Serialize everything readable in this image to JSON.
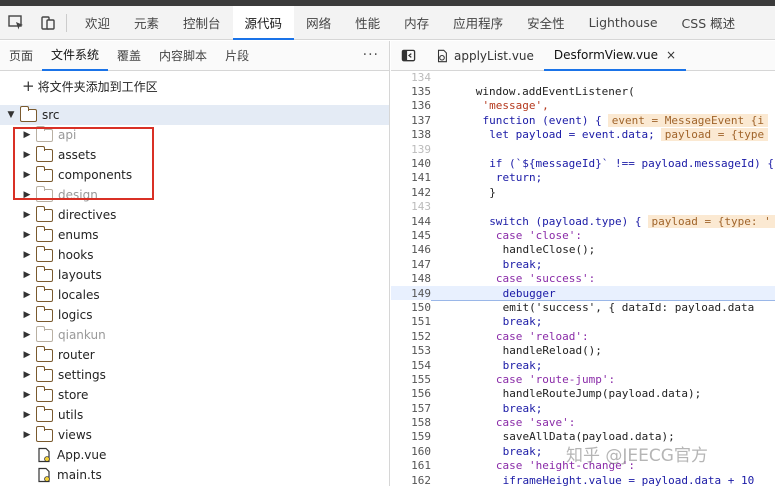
{
  "devtools_tabs": [
    "欢迎",
    "元素",
    "控制台",
    "源代码",
    "网络",
    "性能",
    "内存",
    "应用程序",
    "安全性",
    "Lighthouse",
    "CSS 概述"
  ],
  "active_tab": "源代码",
  "sources_subtabs": [
    "页面",
    "文件系统",
    "覆盖",
    "内容脚本",
    "片段"
  ],
  "active_subtab": "文件系统",
  "more_label": "···",
  "add_folder_label": "将文件夹添加到工作区",
  "tree": {
    "root": "src",
    "items": [
      {
        "label": "api",
        "dim": true
      },
      {
        "label": "assets",
        "dim": false
      },
      {
        "label": "components",
        "dim": false
      },
      {
        "label": "design",
        "dim": true
      },
      {
        "label": "directives",
        "dim": false
      },
      {
        "label": "enums",
        "dim": false
      },
      {
        "label": "hooks",
        "dim": false
      },
      {
        "label": "layouts",
        "dim": false
      },
      {
        "label": "locales",
        "dim": false
      },
      {
        "label": "logics",
        "dim": false
      },
      {
        "label": "qiankun",
        "dim": true
      },
      {
        "label": "router",
        "dim": false
      },
      {
        "label": "settings",
        "dim": false
      },
      {
        "label": "store",
        "dim": false
      },
      {
        "label": "utils",
        "dim": false
      },
      {
        "label": "views",
        "dim": false
      }
    ],
    "files": [
      "App.vue",
      "main.ts"
    ]
  },
  "file_tabs": [
    "applyList.vue",
    "DesformView.vue"
  ],
  "active_file": "DesformView.vue",
  "close_glyph": "×",
  "code_lines": [
    {
      "n": "134",
      "t": "",
      "dim": true
    },
    {
      "n": "135",
      "t": "window.addEventListener("
    },
    {
      "n": "136",
      "t": "'message',"
    },
    {
      "n": "137",
      "t": "function (event) {",
      "hint": "event = MessageEvent {i"
    },
    {
      "n": "138",
      "t": "let payload = event.data;",
      "hint": "payload = {type"
    },
    {
      "n": "139",
      "t": "",
      "dim": true
    },
    {
      "n": "140",
      "t": "if (`${messageId}` !== payload.messageId) {"
    },
    {
      "n": "141",
      "t": "return;"
    },
    {
      "n": "142",
      "t": "}"
    },
    {
      "n": "143",
      "t": "",
      "dim": true
    },
    {
      "n": "144",
      "t": "switch (payload.type) {",
      "hint": "payload = {type: '"
    },
    {
      "n": "145",
      "t": "case 'close':"
    },
    {
      "n": "146",
      "t": "handleClose();"
    },
    {
      "n": "147",
      "t": "break;"
    },
    {
      "n": "148",
      "t": "case 'success':"
    },
    {
      "n": "149",
      "t": "debugger"
    },
    {
      "n": "150",
      "t": "emit('success', { dataId: payload.data"
    },
    {
      "n": "151",
      "t": "break;"
    },
    {
      "n": "152",
      "t": "case 'reload':"
    },
    {
      "n": "153",
      "t": "handleReload();"
    },
    {
      "n": "154",
      "t": "break;"
    },
    {
      "n": "155",
      "t": "case 'route-jump':"
    },
    {
      "n": "156",
      "t": "handleRouteJump(payload.data);"
    },
    {
      "n": "157",
      "t": "break;"
    },
    {
      "n": "158",
      "t": "case 'save':"
    },
    {
      "n": "159",
      "t": "saveAllData(payload.data);"
    },
    {
      "n": "160",
      "t": "break;"
    },
    {
      "n": "161",
      "t": "case 'height-change':"
    },
    {
      "n": "162",
      "t": "iframeHeight.value = payload.data + 10"
    }
  ],
  "watermark": "知乎 @JEECG官方"
}
